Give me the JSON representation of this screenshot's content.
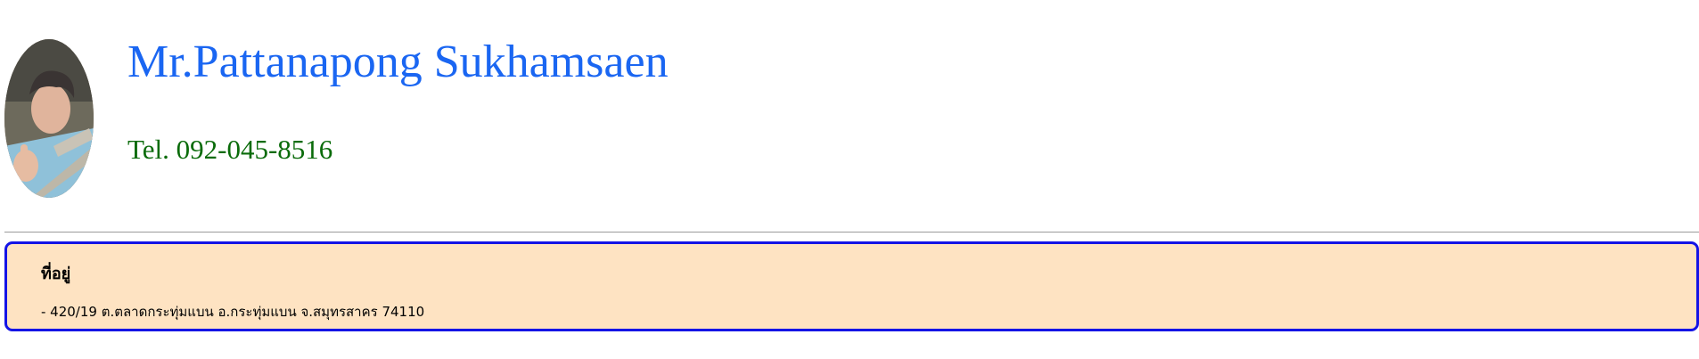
{
  "profile": {
    "avatar_alt": "profile photo",
    "name": "Mr.Pattanapong Sukhamsaen",
    "phone": "Tel. 092-045-8516"
  },
  "address": {
    "title": "ที่อยู่",
    "line": "- 420/19 ต.ตลาดกระทุ่มแบน อ.กระทุ่มแบน จ.สมุทรสาคร 74110"
  },
  "colors": {
    "name": "#1a66f2",
    "phone": "#0a6b0a",
    "box_bg": "#fee3c2",
    "box_border": "#1414e6"
  }
}
